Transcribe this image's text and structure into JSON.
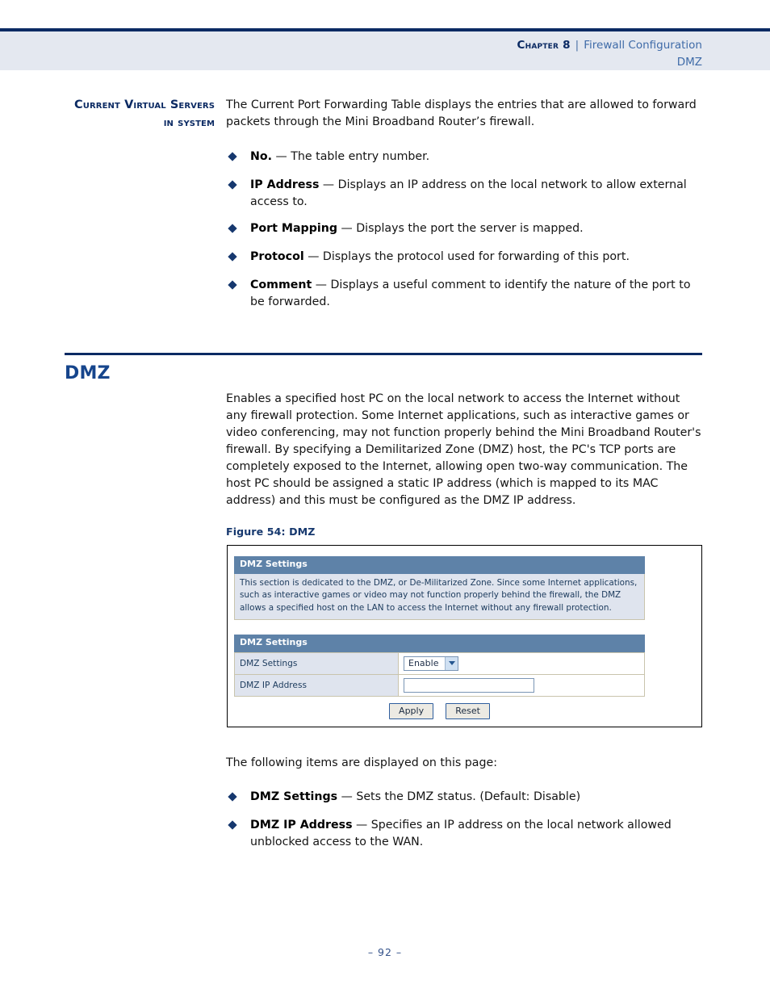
{
  "header": {
    "chapter": "Chapter 8",
    "separator": "|",
    "title": "Firewall Configuration",
    "subtitle": "DMZ"
  },
  "section_servers": {
    "side_head": "Current Virtual Servers in system",
    "intro": "The Current Port Forwarding Table displays the entries that are allowed to forward packets through the Mini Broadband Router’s firewall.",
    "items": [
      {
        "term": "No.",
        "dash": " — ",
        "desc": "The table entry number."
      },
      {
        "term": "IP Address",
        "dash": " — ",
        "desc": "Displays an IP address on the local network to allow external access to."
      },
      {
        "term": "Port Mapping",
        "dash": " — ",
        "desc": "Displays the port the server is mapped."
      },
      {
        "term": "Protocol",
        "dash": " — ",
        "desc": "Displays the protocol used for forwarding of this port."
      },
      {
        "term": "Comment",
        "dash": " — ",
        "desc": "Displays a useful comment to identify the nature of the port to be forwarded."
      }
    ]
  },
  "section_dmz": {
    "title": "DMZ",
    "body": "Enables a specified host PC on the local network to access the Internet without any firewall protection. Some Internet applications, such as interactive games or video conferencing, may not function properly behind the Mini Broadband Router's firewall. By specifying a Demilitarized Zone (DMZ) host, the PC's TCP ports are completely exposed to the Internet, allowing open two-way communication. The host PC should be assigned a static IP address (which is mapped to its MAC address) and this must be configured as the DMZ IP address.",
    "figure_caption": "Figure 54:  DMZ",
    "following_intro": "The following items are displayed on this page:",
    "items": [
      {
        "term": "DMZ Settings",
        "dash": " — ",
        "desc": "Sets the DMZ status. (Default: Disable)"
      },
      {
        "term": "DMZ IP Address",
        "dash": " — ",
        "desc": "Specifies an IP address on the local network allowed unblocked access to the WAN."
      }
    ]
  },
  "figure": {
    "info_panel": {
      "title": "DMZ Settings",
      "description": "This section is dedicated to the DMZ, or De-Militarized Zone. Since some Internet applications, such as interactive games or video may not function properly behind the firewall, the DMZ allows a specified host on the LAN to access the Internet without any firewall protection."
    },
    "form_panel": {
      "title": "DMZ Settings",
      "rows": [
        {
          "label": "DMZ Settings",
          "control": "select",
          "value": "Enable"
        },
        {
          "label": "DMZ IP Address",
          "control": "text",
          "value": ""
        }
      ]
    },
    "buttons": {
      "apply": "Apply",
      "reset": "Reset"
    }
  },
  "footer": {
    "page": "–  92  –"
  },
  "colors": {
    "navy": "#0b2a63",
    "heading_blue": "#16458c",
    "header_band": "#e4e8f0",
    "ui_bar": "#5e82a8",
    "ui_cell": "#dfe4ee"
  }
}
